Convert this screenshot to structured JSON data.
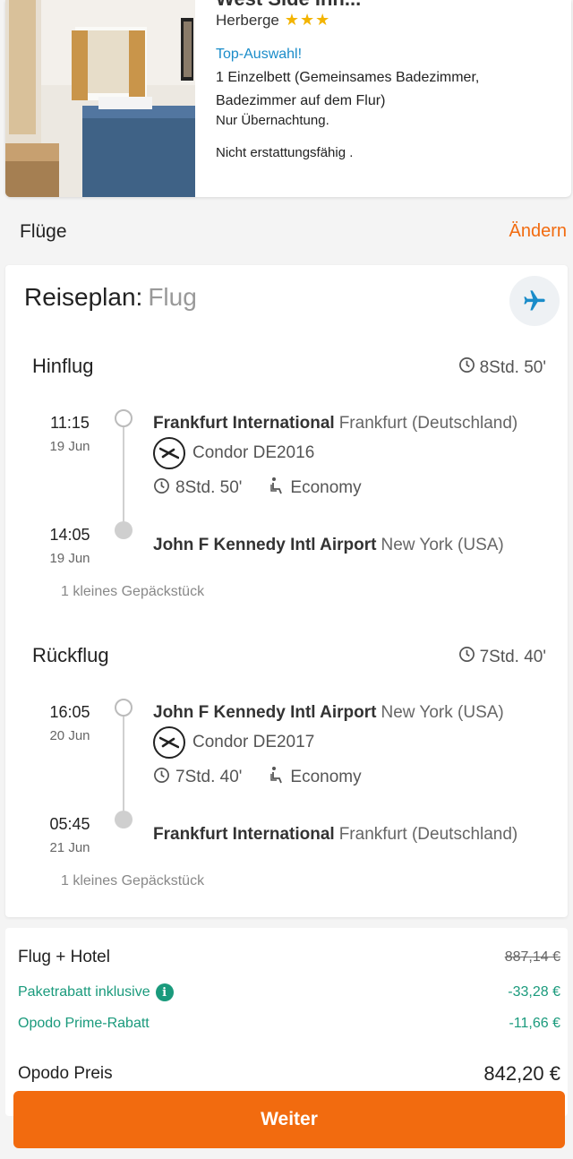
{
  "hotel": {
    "title": "West Side Inn...",
    "type": "Herberge",
    "stars": "★★★",
    "top_pick": "Top-Auswahl!",
    "room": "1 Einzelbett (Gemeinsames Badezimmer, Badezimmer auf dem Flur)",
    "board": "Nur Übernachtung.",
    "cancellation": "Nicht erstattungsfähig ."
  },
  "flights_section": {
    "title": "Flüge",
    "change_label": "Ändern"
  },
  "itinerary": {
    "title": "Reiseplan:",
    "subtitle": "Flug",
    "legs": [
      {
        "label": "Hinflug",
        "duration": "8Std. 50'",
        "departure": {
          "time": "11:15",
          "date": "19 Jun",
          "airport": "Frankfurt International",
          "city": "Frankfurt (Deutschland)"
        },
        "airline": "Condor DE2016",
        "flight_duration": "8Std. 50'",
        "cabin": "Economy",
        "arrival": {
          "time": "14:05",
          "date": "19 Jun",
          "airport": "John F Kennedy Intl Airport",
          "city": "New York (USA)"
        },
        "baggage": "1 kleines Gepäckstück"
      },
      {
        "label": "Rückflug",
        "duration": "7Std. 40'",
        "departure": {
          "time": "16:05",
          "date": "20 Jun",
          "airport": "John F Kennedy Intl Airport",
          "city": "New York (USA)"
        },
        "airline": "Condor DE2017",
        "flight_duration": "7Std. 40'",
        "cabin": "Economy",
        "arrival": {
          "time": "05:45",
          "date": "21 Jun",
          "airport": "Frankfurt International",
          "city": "Frankfurt (Deutschland)"
        },
        "baggage": "1 kleines Gepäckstück"
      }
    ]
  },
  "price": {
    "flight_hotel_label": "Flug + Hotel",
    "flight_hotel_value": "887,14 €",
    "package_discount_label": "Paketrabatt inklusive",
    "package_discount_value": "-33,28 €",
    "prime_discount_label": "Opodo Prime-Rabatt",
    "prime_discount_value": "-11,66 €",
    "total_label": "Opodo Preis",
    "total_value": "842,20 €"
  },
  "continue_label": "Weiter",
  "colors": {
    "accent": "#f26b0f",
    "link_blue": "#1a8cc9",
    "discount_green": "#1a9a7c",
    "star_yellow": "#f3b400"
  }
}
